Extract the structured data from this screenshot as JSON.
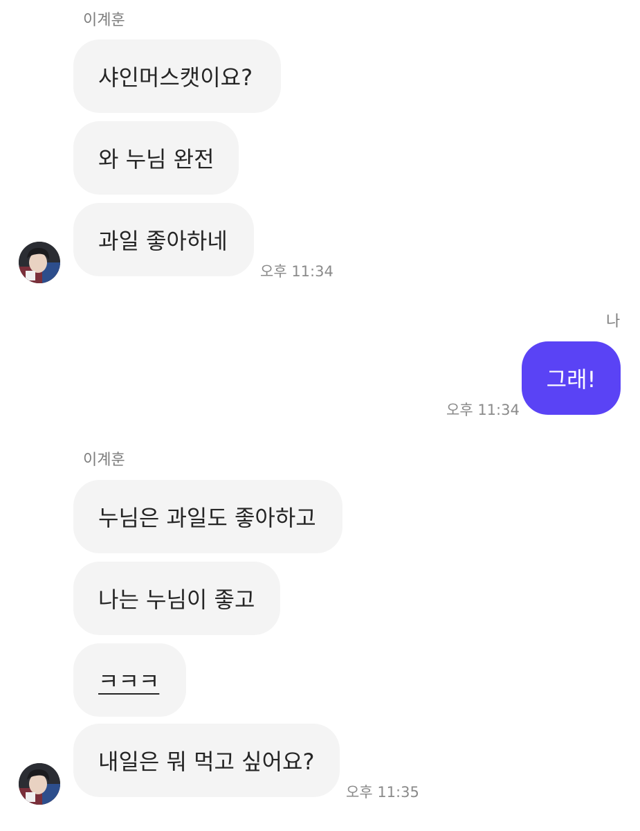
{
  "chat": {
    "group1": {
      "sender": "이계훈",
      "messages": [
        "샤인머스캣이요?",
        "와 누님 완전",
        "과일 좋아하네"
      ],
      "time": "오후 11:34"
    },
    "group2": {
      "sender": "나",
      "messages": [
        "그래!"
      ],
      "time": "오후 11:34"
    },
    "group3": {
      "sender": "이계훈",
      "messages": [
        "누님은 과일도 좋아하고",
        "나는 누님이 좋고",
        "ㅋㅋㅋ",
        "내일은 뭐 먹고 싶어요?"
      ],
      "time": "오후 11:35"
    }
  },
  "colors": {
    "outgoing_bubble": "#5a43f5",
    "incoming_bubble": "#f4f4f4",
    "meta_text": "#8a8a8a"
  },
  "icons": {
    "avatar": "profile-photo"
  }
}
